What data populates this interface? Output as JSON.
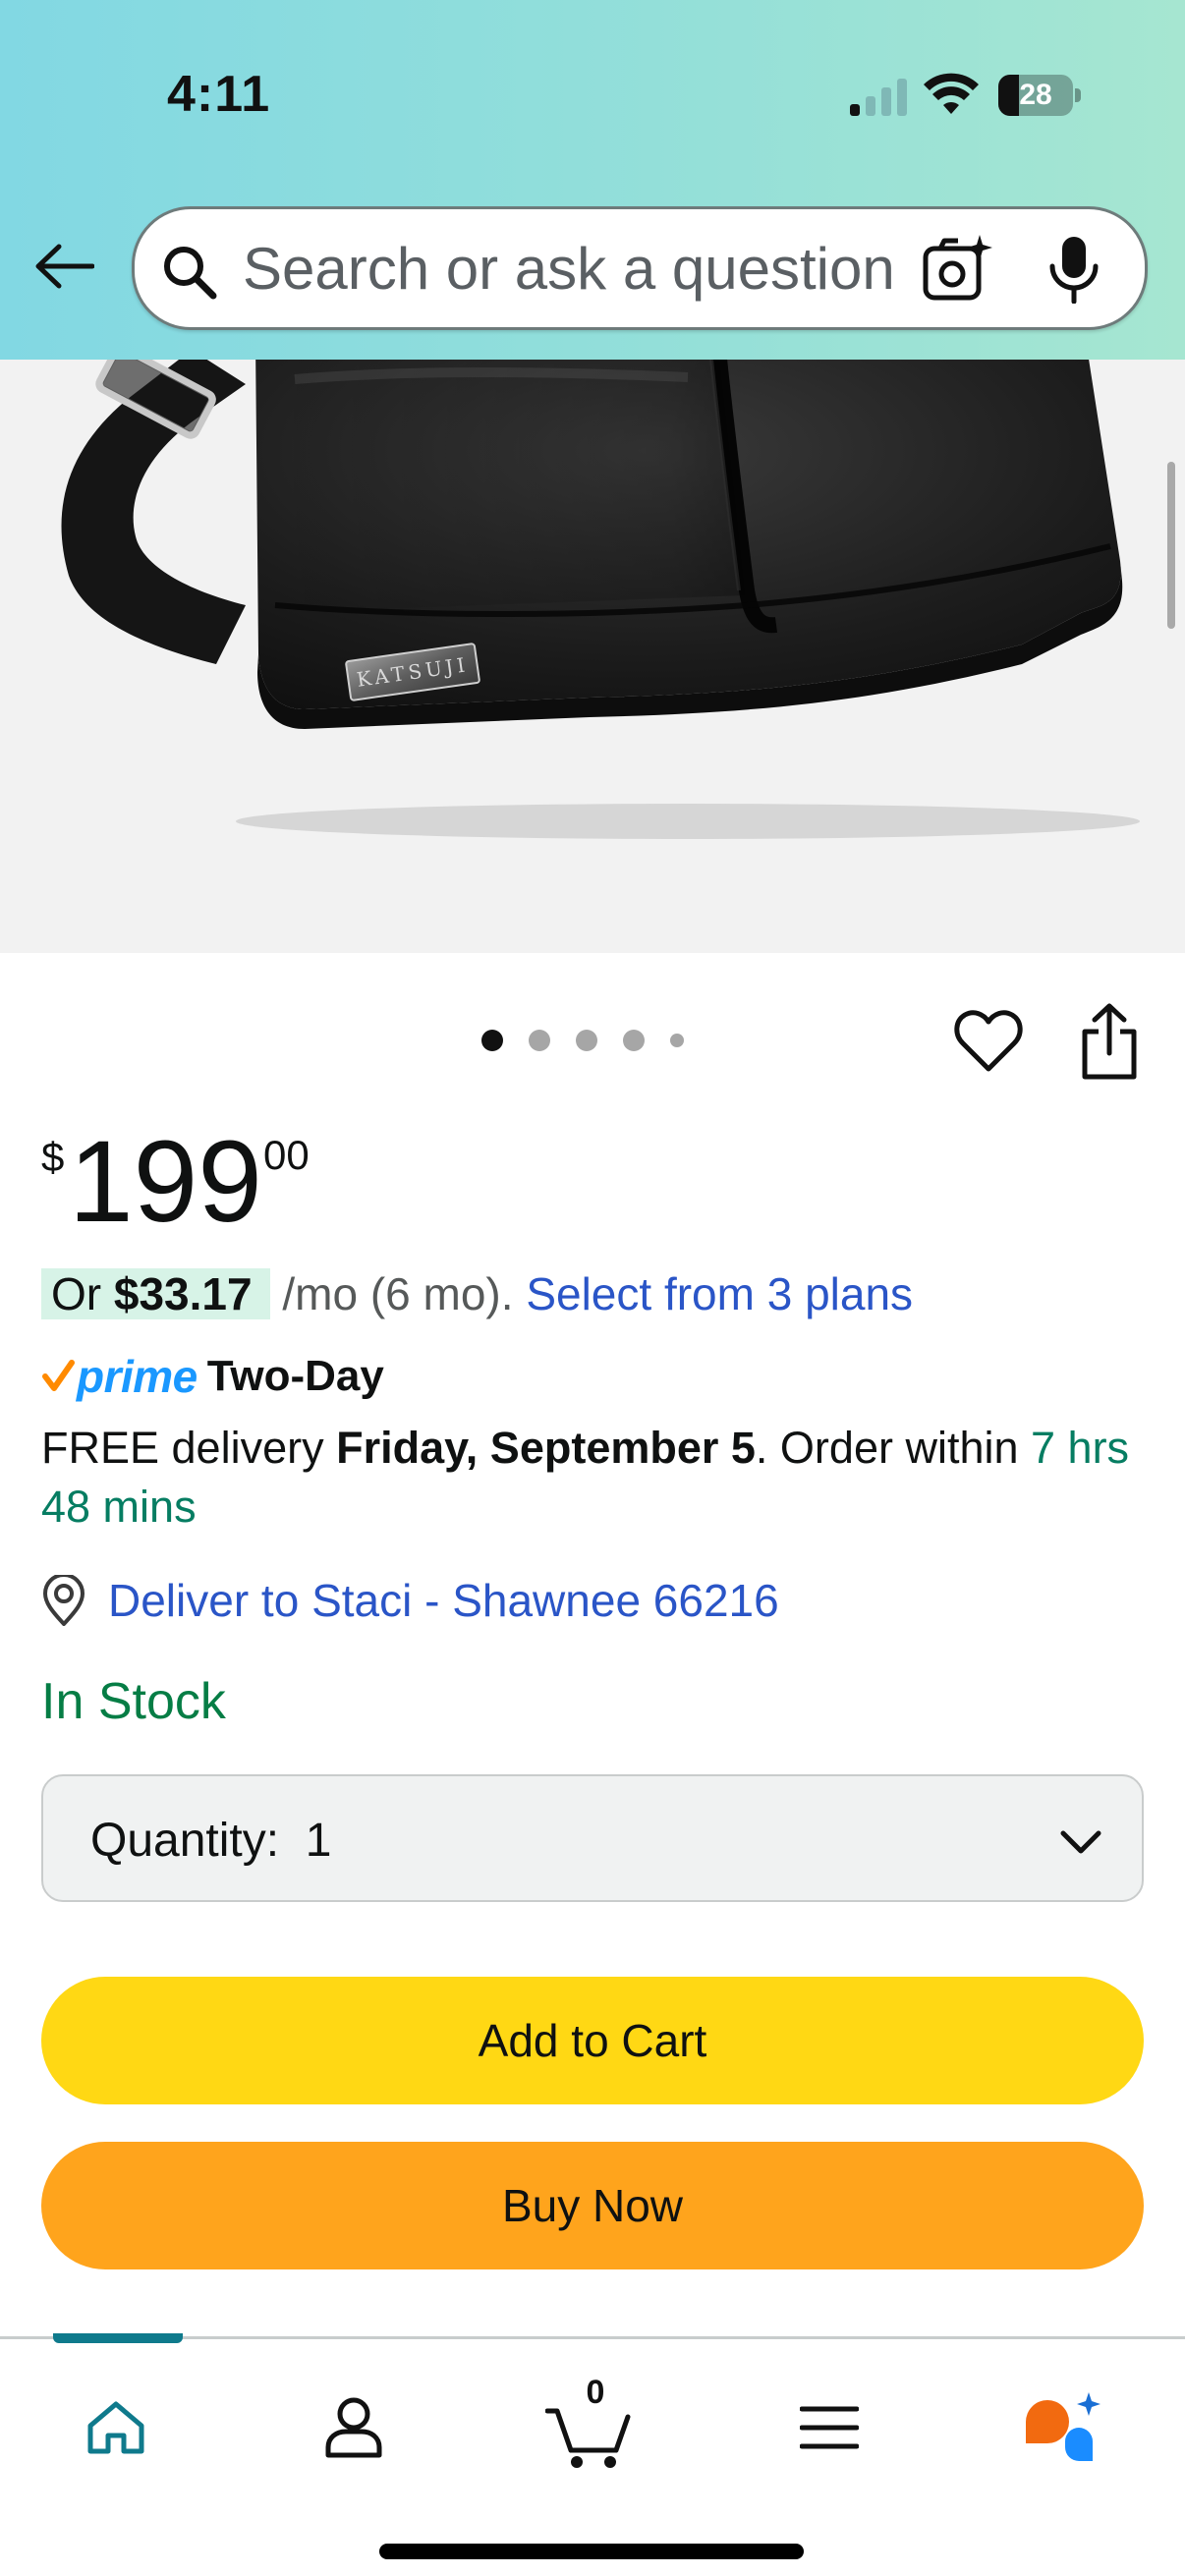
{
  "status_bar": {
    "time": "4:11",
    "battery_level": "28"
  },
  "header": {
    "search": {
      "placeholder": "Search or ask a question"
    }
  },
  "product": {
    "image": {
      "brand_plate": "KATSUJI",
      "carousel_count": 5,
      "carousel_active": 1
    },
    "price": {
      "symbol": "$",
      "whole": "199",
      "fraction": "00"
    },
    "plan": {
      "prefix": "Or ",
      "amount": "$33.17",
      "suffix": " /mo (6 mo). ",
      "link": "Select from 3 plans"
    },
    "prime": {
      "word": "prime",
      "label": "Two-Day"
    },
    "delivery": {
      "prefix": "FREE delivery ",
      "date": "Friday, September 5",
      "middle": ". Order within ",
      "countdown": "7 hrs 48 mins"
    },
    "deliver_to": "Deliver to Staci - Shawnee 66216",
    "stock": "In Stock",
    "quantity": {
      "label": "Quantity:",
      "value": "1"
    },
    "add_to_cart": "Add to Cart",
    "buy_now": "Buy Now"
  },
  "bottom_nav": {
    "cart_count": "0",
    "items": [
      "home",
      "account",
      "cart",
      "menu",
      "rufus"
    ]
  },
  "colors": {
    "header_gradient": [
      "#82d8e3",
      "#a6e6d1"
    ],
    "link": "#2a55c7",
    "in_stock": "#067d45",
    "countdown": "#067d62",
    "add_to_cart": "#ffd814",
    "buy_now": "#ffa41c",
    "prime_blue": "#1a98ff",
    "prime_check": "#ff8a00",
    "nav_active": "#0f7a8c"
  }
}
